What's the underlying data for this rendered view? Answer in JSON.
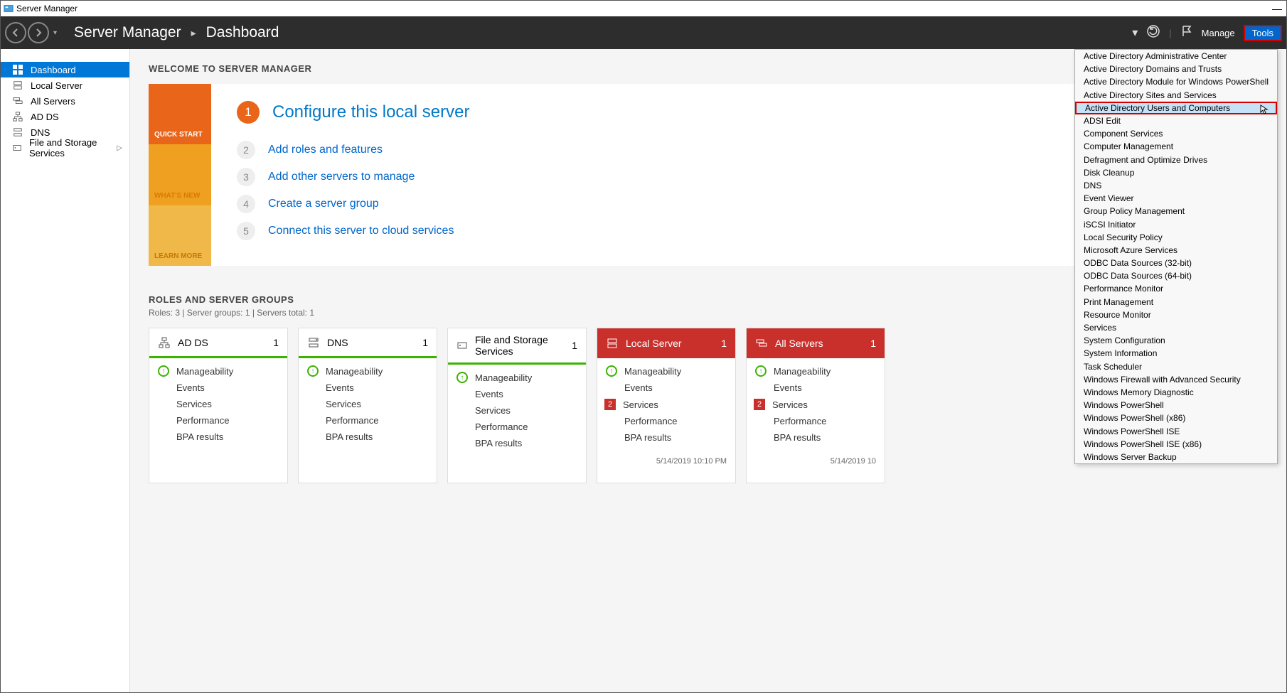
{
  "titlebar": {
    "title": "Server Manager"
  },
  "breadcrumb": {
    "app": "Server Manager",
    "page": "Dashboard"
  },
  "toolbar": {
    "manage": "Manage",
    "tools": "Tools"
  },
  "sidebar": {
    "items": [
      {
        "label": "Dashboard"
      },
      {
        "label": "Local Server"
      },
      {
        "label": "All Servers"
      },
      {
        "label": "AD DS"
      },
      {
        "label": "DNS"
      },
      {
        "label": "File and Storage Services"
      }
    ]
  },
  "welcome": {
    "title": "WELCOME TO SERVER MANAGER",
    "tabs": {
      "quick": "QUICK START",
      "whats": "WHAT'S NEW",
      "learn": "LEARN MORE"
    },
    "steps": [
      {
        "n": "1",
        "label": "Configure this local server"
      },
      {
        "n": "2",
        "label": "Add roles and features"
      },
      {
        "n": "3",
        "label": "Add other servers to manage"
      },
      {
        "n": "4",
        "label": "Create a server group"
      },
      {
        "n": "5",
        "label": "Connect this server to cloud services"
      }
    ]
  },
  "groups": {
    "title": "ROLES AND SERVER GROUPS",
    "sub": "Roles: 3   |   Server groups: 1   |   Servers total: 1",
    "rows": {
      "manage": "Manageability",
      "events": "Events",
      "services": "Services",
      "perf": "Performance",
      "bpa": "BPA results"
    },
    "tiles": [
      {
        "title": "AD DS",
        "count": "1",
        "red": false,
        "badge": null,
        "ts": ""
      },
      {
        "title": "DNS",
        "count": "1",
        "red": false,
        "badge": null,
        "ts": ""
      },
      {
        "title": "File and Storage Services",
        "count": "1",
        "red": false,
        "badge": null,
        "ts": ""
      },
      {
        "title": "Local Server",
        "count": "1",
        "red": true,
        "badge": "2",
        "ts": "5/14/2019 10:10 PM"
      },
      {
        "title": "All Servers",
        "count": "1",
        "red": true,
        "badge": "2",
        "ts": "5/14/2019 10"
      }
    ]
  },
  "tools_menu": {
    "items": [
      "Active Directory Administrative Center",
      "Active Directory Domains and Trusts",
      "Active Directory Module for Windows PowerShell",
      "Active Directory Sites and Services",
      "Active Directory Users and Computers",
      "ADSI Edit",
      "Component Services",
      "Computer Management",
      "Defragment and Optimize Drives",
      "Disk Cleanup",
      "DNS",
      "Event Viewer",
      "Group Policy Management",
      "iSCSI Initiator",
      "Local Security Policy",
      "Microsoft Azure Services",
      "ODBC Data Sources (32-bit)",
      "ODBC Data Sources (64-bit)",
      "Performance Monitor",
      "Print Management",
      "Resource Monitor",
      "Services",
      "System Configuration",
      "System Information",
      "Task Scheduler",
      "Windows Firewall with Advanced Security",
      "Windows Memory Diagnostic",
      "Windows PowerShell",
      "Windows PowerShell (x86)",
      "Windows PowerShell ISE",
      "Windows PowerShell ISE (x86)",
      "Windows Server Backup"
    ],
    "highlighted_index": 4
  }
}
